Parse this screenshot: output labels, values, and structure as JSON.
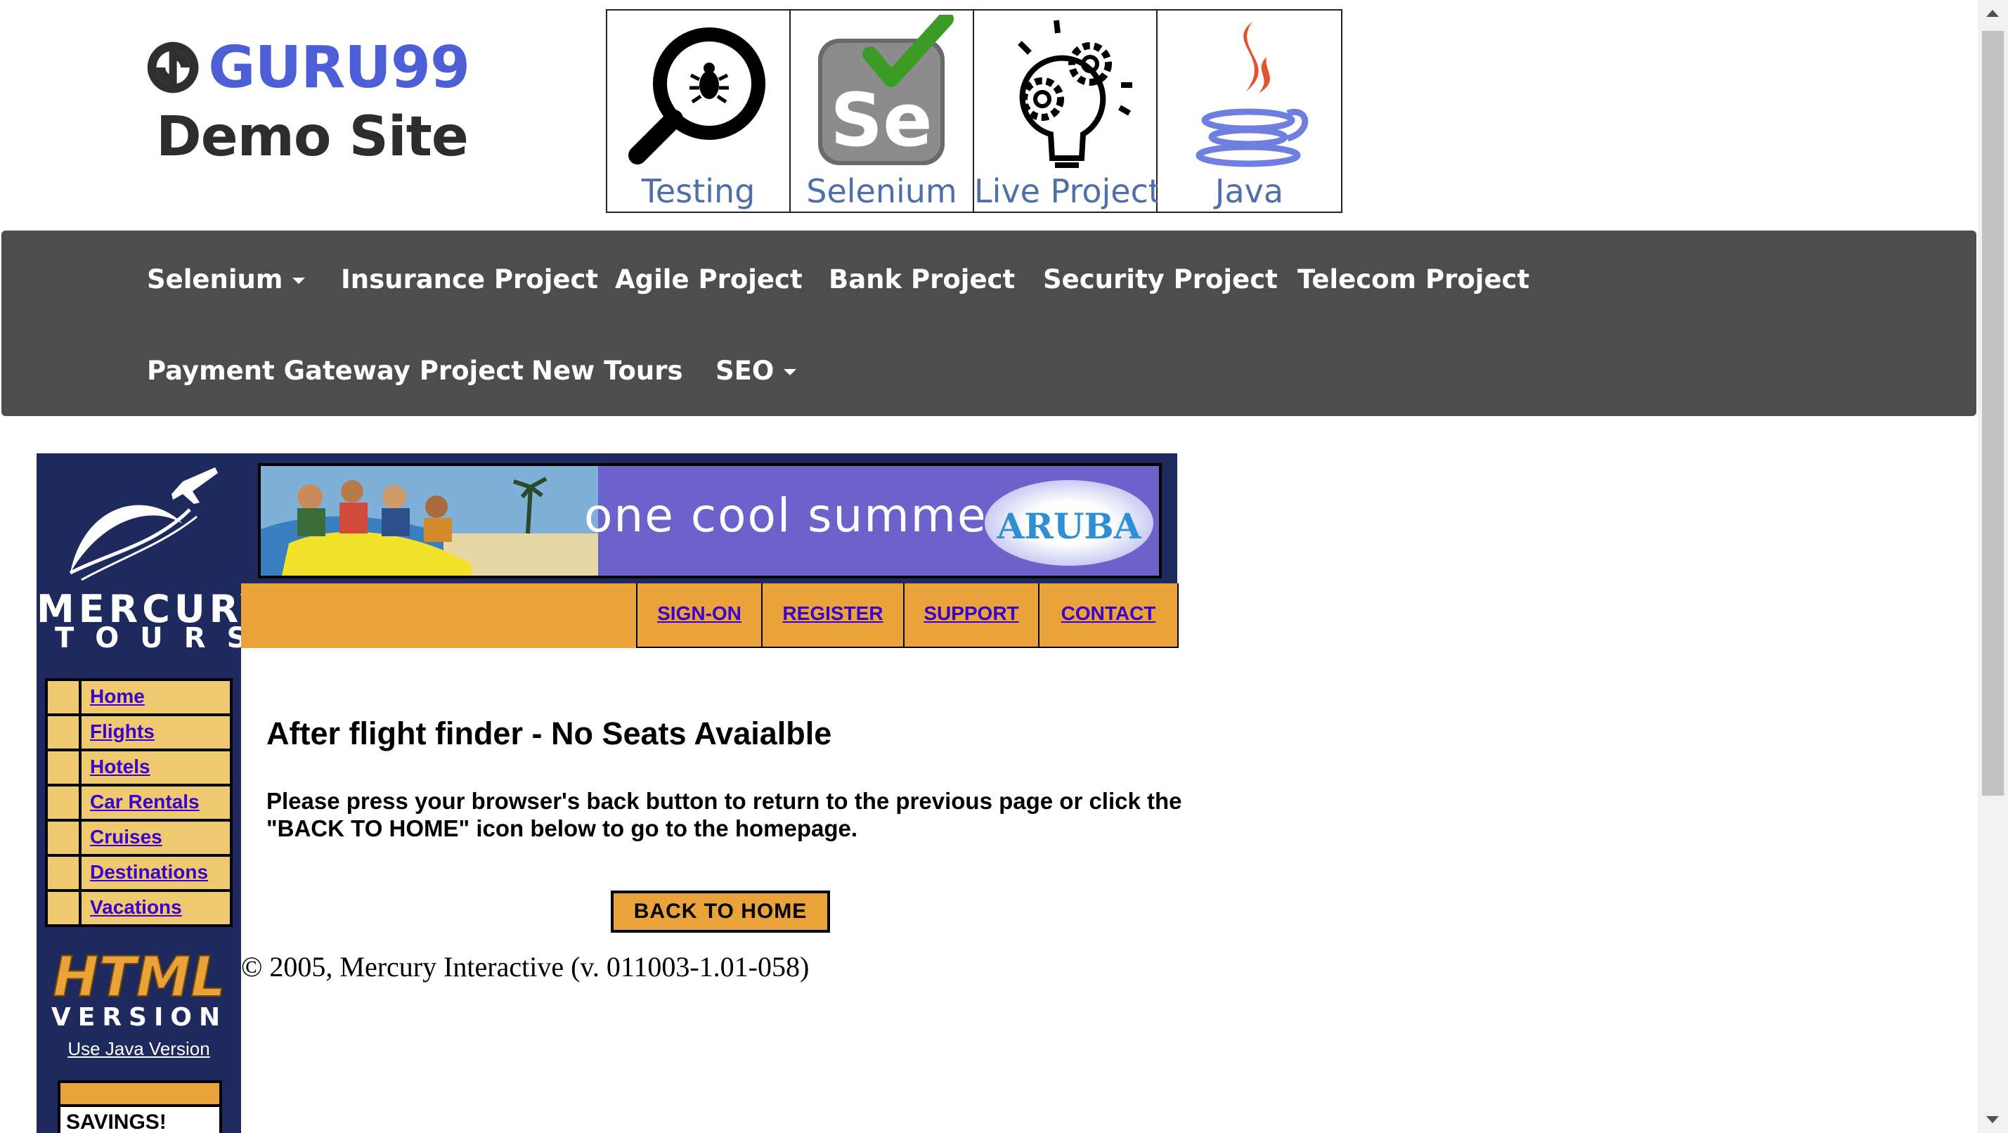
{
  "header": {
    "brand": "GURU99",
    "subtitle": "Demo Site",
    "tiles": [
      {
        "label": "Testing",
        "icon": "magnifier-bug-icon"
      },
      {
        "label": "Selenium",
        "icon": "selenium-logo-icon"
      },
      {
        "label": "Live Project",
        "icon": "lightbulb-gears-icon"
      },
      {
        "label": "Java",
        "icon": "java-logo-icon"
      }
    ]
  },
  "nav": {
    "row1": [
      "Selenium",
      "Insurance Project",
      "Agile Project",
      "Bank Project",
      "Security Project",
      "Telecom Project"
    ],
    "row2": [
      "Payment Gateway Project",
      "New Tours",
      "SEO"
    ]
  },
  "mercury": {
    "logo_word1": "MERCURY",
    "logo_word2": "TOURS",
    "side_menu": [
      "Home",
      "Flights",
      "Hotels",
      "Car Rentals",
      "Cruises",
      "Destinations",
      "Vacations"
    ],
    "html_word": "HTML",
    "version_word": "VERSION",
    "java_link": "Use Java Version",
    "savings": "SAVINGS!",
    "banner_text": "one cool summer",
    "banner_brand": "ARUBA",
    "top_links": [
      "SIGN-ON",
      "REGISTER",
      "SUPPORT",
      "CONTACT"
    ]
  },
  "content": {
    "heading": "After flight finder - No Seats Avaialble",
    "message": "Please press your browser's back button to return to the previous page or click the \"BACK TO HOME\" icon below to go to the homepage.",
    "back_button": "BACK TO HOME",
    "copyright": "© 2005, Mercury Interactive (v. 011003-1.01-058)"
  },
  "colors": {
    "brand_blue": "#4c5fd6",
    "nav_bg": "#4d4d4d",
    "mercury_navy": "#1e2a5e",
    "mercury_orange": "#e9a33a",
    "menu_tan": "#eec970",
    "link_purple": "#3a00cc"
  }
}
